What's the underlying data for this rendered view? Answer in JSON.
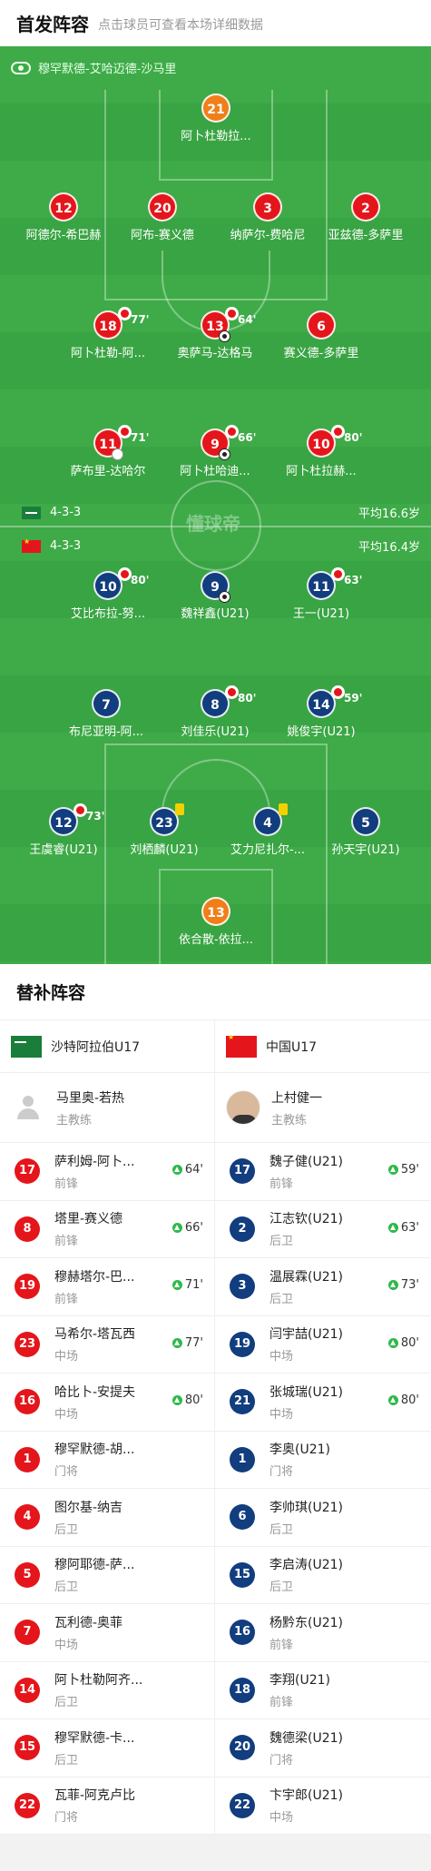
{
  "header": {
    "title": "首发阵容",
    "subtitle": "点击球员可查看本场详细数据"
  },
  "pitch": {
    "referee": "穆罕默德-艾哈迈德-沙马里",
    "watermark": "懂球帝",
    "home_team": {
      "formation": "4-3-3",
      "avg_age": "平均16.6岁"
    },
    "away_team": {
      "formation": "4-3-3",
      "avg_age": "平均16.4岁"
    },
    "home_players": [
      {
        "number": "21",
        "name": "阿卜杜勒拉...",
        "style": "orange",
        "sub": "",
        "goal": false
      },
      {
        "number": "12",
        "name": "阿德尔-希巴赫",
        "style": "red",
        "sub": "",
        "goal": false
      },
      {
        "number": "20",
        "name": "阿布-赛义德",
        "style": "red",
        "sub": "",
        "goal": false
      },
      {
        "number": "3",
        "name": "纳萨尔-费哈尼",
        "style": "red",
        "sub": "",
        "goal": false
      },
      {
        "number": "2",
        "name": "亚兹德-多萨里",
        "style": "red",
        "sub": "",
        "goal": false
      },
      {
        "number": "18",
        "name": "阿卜杜勒-阿...",
        "style": "red",
        "sub": "77'",
        "goal": false
      },
      {
        "number": "13",
        "name": "奥萨马-达格马",
        "style": "red",
        "sub": "64'",
        "goal": true
      },
      {
        "number": "6",
        "name": "赛义德-多萨里",
        "style": "red",
        "sub": "",
        "goal": false
      },
      {
        "number": "11",
        "name": "萨布里-达哈尔",
        "style": "red",
        "sub": "71'",
        "goal": false,
        "own_goal": true
      },
      {
        "number": "9",
        "name": "阿卜杜哈迪...",
        "style": "red",
        "sub": "66'",
        "goal": true
      },
      {
        "number": "10",
        "name": "阿卜杜拉赫...",
        "style": "red",
        "sub": "80'",
        "goal": false
      }
    ],
    "away_players": [
      {
        "number": "10",
        "name": "艾比布拉-努...",
        "sub": "80'",
        "goal": false,
        "card": false
      },
      {
        "number": "9",
        "name": "魏祥鑫(U21)",
        "sub": "",
        "goal": true,
        "card": false
      },
      {
        "number": "11",
        "name": "王一(U21)",
        "sub": "63'",
        "goal": false,
        "card": false
      },
      {
        "number": "7",
        "name": "布尼亚明-阿...",
        "sub": "",
        "goal": false,
        "card": false
      },
      {
        "number": "8",
        "name": "刘佳乐(U21)",
        "sub": "80'",
        "goal": false,
        "card": false
      },
      {
        "number": "14",
        "name": "姚俊宇(U21)",
        "sub": "59'",
        "goal": false,
        "card": false
      },
      {
        "number": "12",
        "name": "王虞睿(U21)",
        "sub": "73'",
        "goal": false,
        "card": false
      },
      {
        "number": "23",
        "name": "刘栖麟(U21)",
        "sub": "",
        "goal": false,
        "card": true
      },
      {
        "number": "4",
        "name": "艾力尼扎尔-...",
        "sub": "",
        "goal": false,
        "card": true
      },
      {
        "number": "5",
        "name": "孙天宇(U21)",
        "sub": "",
        "goal": false,
        "card": false
      },
      {
        "number": "13",
        "name": "依合散-依拉...",
        "sub": "",
        "goal": false,
        "card": false,
        "style": "orange"
      }
    ]
  },
  "subs": {
    "title": "替补阵容",
    "home": {
      "team": "沙特阿拉伯U17",
      "coach": {
        "name": "马里奥-若热",
        "role": "主教练"
      },
      "players": [
        {
          "number": "17",
          "name": "萨利姆-阿卜...",
          "pos": "前锋",
          "in": "64'"
        },
        {
          "number": "8",
          "name": "塔里-赛义德",
          "pos": "前锋",
          "in": "66'"
        },
        {
          "number": "19",
          "name": "穆赫塔尔-巴...",
          "pos": "前锋",
          "in": "71'"
        },
        {
          "number": "23",
          "name": "马希尔-塔瓦西",
          "pos": "中场",
          "in": "77'"
        },
        {
          "number": "16",
          "name": "哈比卜-安提夫",
          "pos": "中场",
          "in": "80'"
        },
        {
          "number": "1",
          "name": "穆罕默德-胡...",
          "pos": "门将",
          "in": ""
        },
        {
          "number": "4",
          "name": "图尔基-纳吉",
          "pos": "后卫",
          "in": ""
        },
        {
          "number": "5",
          "name": "穆阿耶德-萨...",
          "pos": "后卫",
          "in": ""
        },
        {
          "number": "7",
          "name": "瓦利德-奥菲",
          "pos": "中场",
          "in": ""
        },
        {
          "number": "14",
          "name": "阿卜杜勒阿齐...",
          "pos": "后卫",
          "in": ""
        },
        {
          "number": "15",
          "name": "穆罕默德-卡...",
          "pos": "后卫",
          "in": ""
        },
        {
          "number": "22",
          "name": "瓦菲-阿克卢比",
          "pos": "门将",
          "in": ""
        }
      ]
    },
    "away": {
      "team": "中国U17",
      "coach": {
        "name": "上村健一",
        "role": "主教练"
      },
      "players": [
        {
          "number": "17",
          "name": "魏子健(U21)",
          "pos": "前锋",
          "in": "59'"
        },
        {
          "number": "2",
          "name": "江志钦(U21)",
          "pos": "后卫",
          "in": "63'"
        },
        {
          "number": "3",
          "name": "温展霖(U21)",
          "pos": "后卫",
          "in": "73'"
        },
        {
          "number": "19",
          "name": "闫宇喆(U21)",
          "pos": "中场",
          "in": "80'"
        },
        {
          "number": "21",
          "name": "张城瑞(U21)",
          "pos": "中场",
          "in": "80'"
        },
        {
          "number": "1",
          "name": "李奥(U21)",
          "pos": "门将",
          "in": ""
        },
        {
          "number": "6",
          "name": "李帅琪(U21)",
          "pos": "后卫",
          "in": ""
        },
        {
          "number": "15",
          "name": "李启涛(U21)",
          "pos": "后卫",
          "in": ""
        },
        {
          "number": "16",
          "name": "杨黔东(U21)",
          "pos": "前锋",
          "in": ""
        },
        {
          "number": "18",
          "name": "李翔(U21)",
          "pos": "前锋",
          "in": ""
        },
        {
          "number": "20",
          "name": "魏德梁(U21)",
          "pos": "门将",
          "in": ""
        },
        {
          "number": "22",
          "name": "卞宇郎(U21)",
          "pos": "中场",
          "in": ""
        }
      ]
    }
  }
}
